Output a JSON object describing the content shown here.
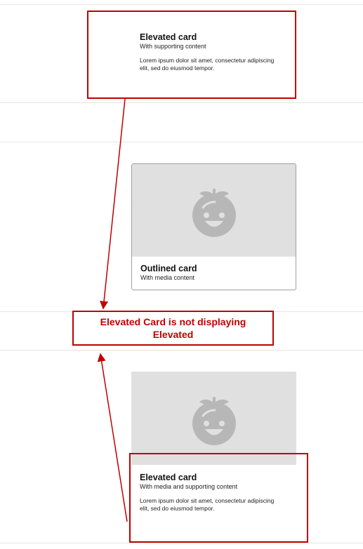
{
  "cards": {
    "elevated_text": {
      "title": "Elevated card",
      "subtitle": "With supporting content",
      "body": "Lorem ipsum dolor sit amet, consectetur adipiscing elit, sed do eiusmod tempor."
    },
    "outlined_media": {
      "title": "Outlined card",
      "subtitle": "With media content"
    },
    "elevated_media": {
      "title": "Elevated card",
      "subtitle": "With media and supporting content",
      "body": "Lorem ipsum dolor sit amet, consectetur adipiscing elit, sed do eiusmod tempor."
    }
  },
  "annotation": {
    "line1": "Elevated Card is not displaying",
    "line2": "Elevated"
  },
  "icons": {
    "media_placeholder": "smiling-fruit-icon"
  },
  "colors": {
    "annotation": "#c00000",
    "media_background": "#e0e0e0",
    "icon": "#b7b7b7"
  }
}
